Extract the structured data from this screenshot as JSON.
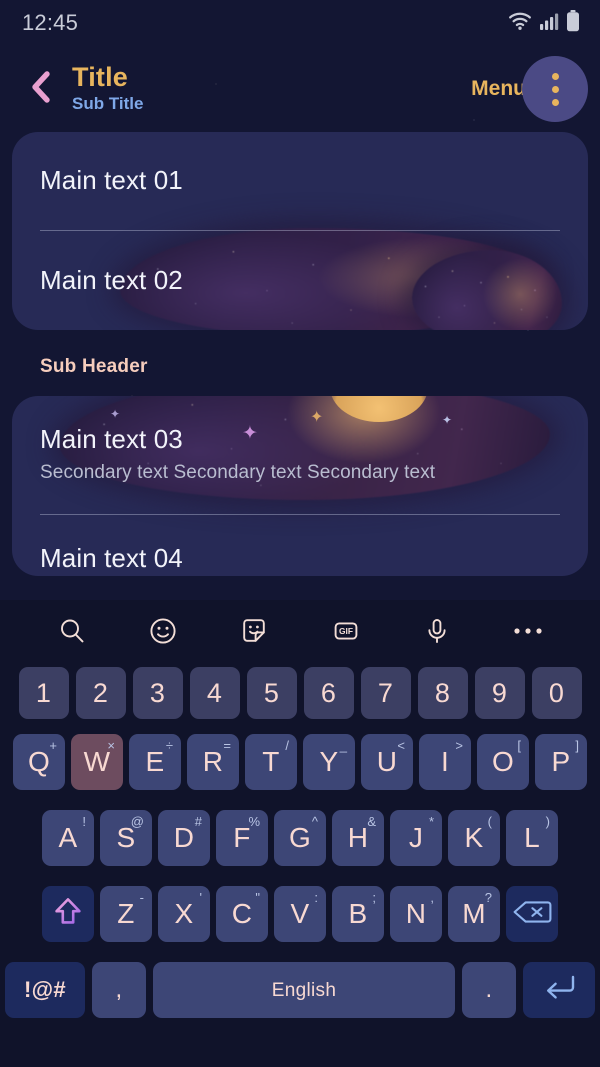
{
  "status_bar": {
    "clock": "12:45",
    "icons": [
      "wifi-icon",
      "cellular-signal-icon",
      "battery-icon"
    ]
  },
  "title_bar": {
    "back_icon": "chevron-left-icon",
    "title": "Title",
    "subtitle": "Sub Title",
    "menu_label": "Menu",
    "menu_icon": "overflow-menu-icon",
    "colors": {
      "title": "#e8b55e",
      "subtitle": "#7fa8e8",
      "back_arrow": "#e9a0d0",
      "menu_circle": "#4b4a85",
      "menu_dots": "#e8b55e"
    }
  },
  "list": {
    "card_color": "#272a56",
    "background_color": "#131633",
    "group_one": [
      {
        "main": "Main text 01",
        "secondary": ""
      },
      {
        "main": "Main text 02",
        "secondary": ""
      }
    ],
    "sub_header": "Sub Header",
    "group_two": [
      {
        "main": "Main text 03",
        "secondary": "Secondary text Secondary text Secondary text"
      },
      {
        "main": "Main text 04",
        "secondary": ""
      }
    ]
  },
  "keyboard": {
    "background_color": "#10132a",
    "key_color": "#3d4676",
    "number_key_color": "#3c3f63",
    "special_key_color": "#1d2a5e",
    "pressed_key_color": "#6d4c5f",
    "key_text_color": "#f8d9d2",
    "toolbar": [
      {
        "name": "search-icon",
        "label": ""
      },
      {
        "name": "emoji-icon",
        "label": ""
      },
      {
        "name": "sticker-icon",
        "label": ""
      },
      {
        "name": "gif-icon",
        "label": "GIF"
      },
      {
        "name": "microphone-icon",
        "label": ""
      },
      {
        "name": "more-options-icon",
        "label": ""
      }
    ],
    "number_row": [
      "1",
      "2",
      "3",
      "4",
      "5",
      "6",
      "7",
      "8",
      "9",
      "0"
    ],
    "row_q": [
      {
        "letter": "Q",
        "sup": "+",
        "pressed": false
      },
      {
        "letter": "W",
        "sup": "×",
        "pressed": true
      },
      {
        "letter": "E",
        "sup": "÷",
        "pressed": false
      },
      {
        "letter": "R",
        "sup": "=",
        "pressed": false
      },
      {
        "letter": "T",
        "sup": "/",
        "pressed": false
      },
      {
        "letter": "Y",
        "sup": "_",
        "pressed": false
      },
      {
        "letter": "U",
        "sup": "<",
        "pressed": false
      },
      {
        "letter": "I",
        "sup": ">",
        "pressed": false
      },
      {
        "letter": "O",
        "sup": "[",
        "pressed": false
      },
      {
        "letter": "P",
        "sup": "]",
        "pressed": false
      }
    ],
    "row_a": [
      {
        "letter": "A",
        "sup": "!"
      },
      {
        "letter": "S",
        "sup": "@"
      },
      {
        "letter": "D",
        "sup": "#"
      },
      {
        "letter": "F",
        "sup": "%"
      },
      {
        "letter": "G",
        "sup": "^"
      },
      {
        "letter": "H",
        "sup": "&"
      },
      {
        "letter": "J",
        "sup": "*"
      },
      {
        "letter": "K",
        "sup": "("
      },
      {
        "letter": "L",
        "sup": ")"
      }
    ],
    "row_z": [
      {
        "letter": "Z",
        "sup": "-"
      },
      {
        "letter": "X",
        "sup": "'"
      },
      {
        "letter": "C",
        "sup": "\""
      },
      {
        "letter": "V",
        "sup": ":"
      },
      {
        "letter": "B",
        "sup": ";"
      },
      {
        "letter": "N",
        "sup": ","
      },
      {
        "letter": "M",
        "sup": "?"
      }
    ],
    "shift_icon": "shift-arrow-icon",
    "backspace_icon": "backspace-icon",
    "bottom_row": {
      "symbols_label": "!@#",
      "comma_label": ",",
      "space_label": "English",
      "period_label": ".",
      "enter_icon": "enter-return-icon"
    }
  }
}
